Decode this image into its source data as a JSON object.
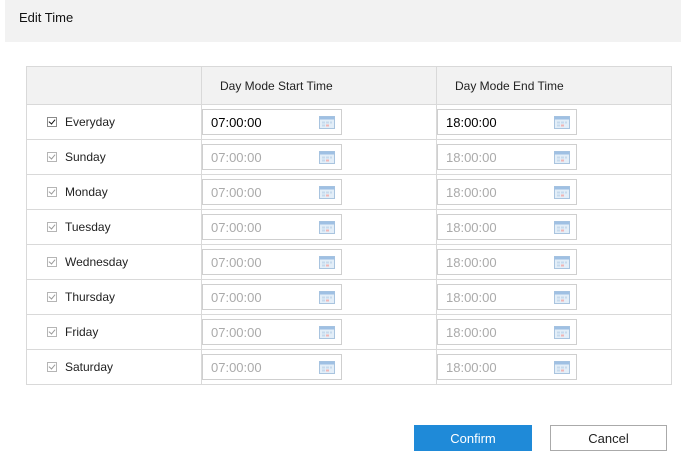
{
  "dialog": {
    "title": "Edit Time"
  },
  "table": {
    "headers": [
      "",
      "Day Mode Start Time",
      "Day Mode End Time"
    ],
    "rows": [
      {
        "day": "Everyday",
        "checked": true,
        "enabled": true,
        "start": "07:00:00",
        "end": "18:00:00"
      },
      {
        "day": "Sunday",
        "checked": true,
        "enabled": false,
        "start": "07:00:00",
        "end": "18:00:00"
      },
      {
        "day": "Monday",
        "checked": true,
        "enabled": false,
        "start": "07:00:00",
        "end": "18:00:00"
      },
      {
        "day": "Tuesday",
        "checked": true,
        "enabled": false,
        "start": "07:00:00",
        "end": "18:00:00"
      },
      {
        "day": "Wednesday",
        "checked": true,
        "enabled": false,
        "start": "07:00:00",
        "end": "18:00:00"
      },
      {
        "day": "Thursday",
        "checked": true,
        "enabled": false,
        "start": "07:00:00",
        "end": "18:00:00"
      },
      {
        "day": "Friday",
        "checked": true,
        "enabled": false,
        "start": "07:00:00",
        "end": "18:00:00"
      },
      {
        "day": "Saturday",
        "checked": true,
        "enabled": false,
        "start": "07:00:00",
        "end": "18:00:00"
      }
    ]
  },
  "buttons": {
    "confirm": "Confirm",
    "cancel": "Cancel"
  },
  "colors": {
    "accent": "#1f8ad8",
    "header_bg": "#f2f2f2",
    "disabled_text": "#aaaaaa"
  },
  "icons": {
    "time_picker": "calendar-icon",
    "checkbox": "checkbox-checked"
  }
}
